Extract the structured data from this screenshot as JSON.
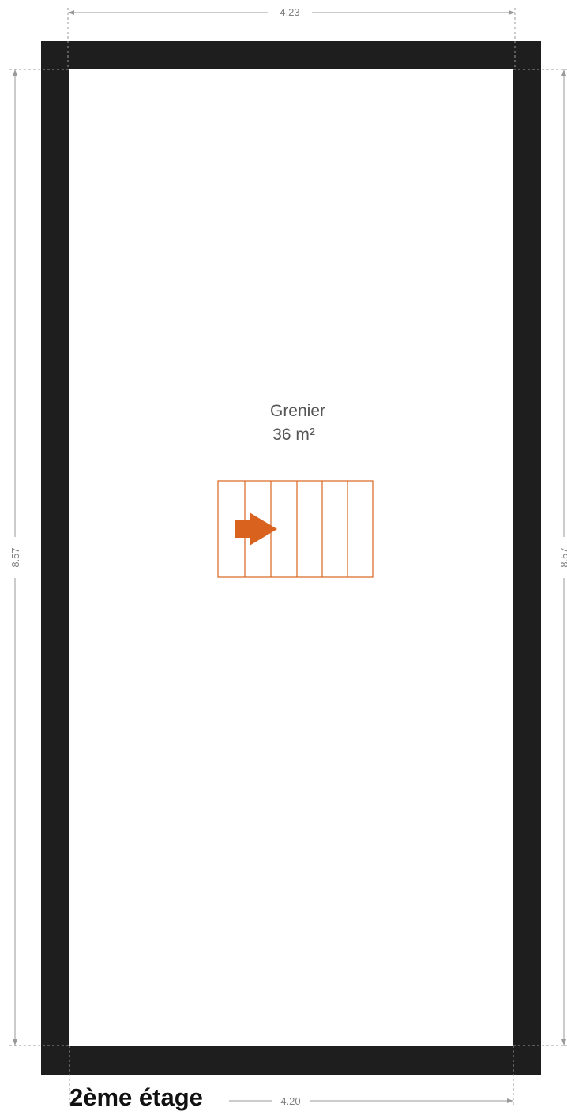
{
  "dimensions": {
    "top_width": "4.23",
    "bottom_width": "4.20",
    "left_height": "8.57",
    "right_height": "8.57"
  },
  "room": {
    "name": "Grenier",
    "area": "36 m²"
  },
  "floor_label": "2ème étage",
  "colors": {
    "wall": "#1e1e1e",
    "stairs": "#d9631e",
    "dimension_line": "#9a9a9a"
  },
  "icons": {
    "stairs_arrow": "arrow-right-icon"
  }
}
